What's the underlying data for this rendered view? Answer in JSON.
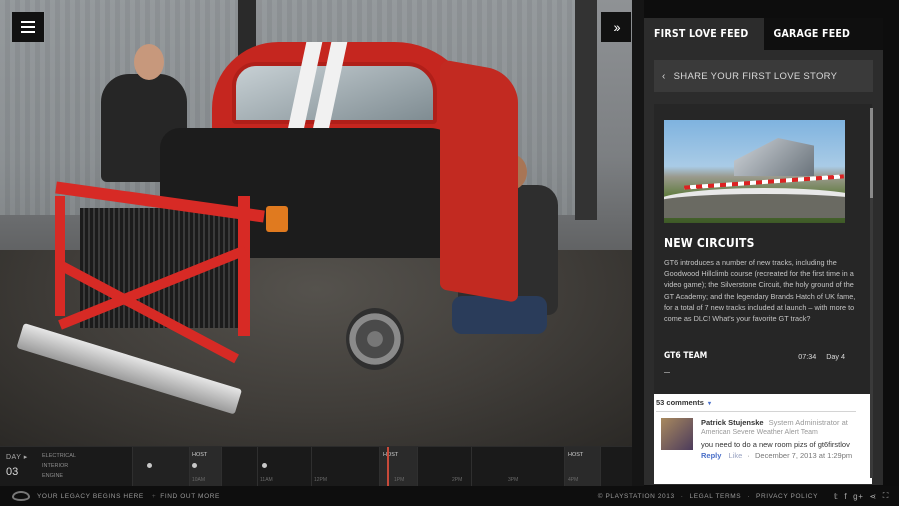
{
  "menu": {
    "icon": "hamburger-icon"
  },
  "collapse": {
    "label": "››",
    "icon": "double-chevron-right-icon"
  },
  "panel": {
    "tabs": [
      {
        "label": "FIRST LOVE FEED",
        "active": true
      },
      {
        "label": "GARAGE FEED",
        "active": false
      }
    ],
    "share": {
      "label": "SHARE YOUR FIRST LOVE STORY",
      "icon": "chevron-left-icon"
    },
    "article": {
      "title": "NEW CIRCUITS",
      "body": "GT6 introduces a number of new tracks, including the Goodwood Hillclimb course (recreated for the first time in a video game); the Silverstone Circuit, the holy ground of the GT Academy; and the legendary Brands Hatch of UK fame, for a total of 7 new tracks included at launch – with more to come as DLC! What's your favorite GT track?",
      "author": "GT6 TEAM",
      "time": "07:34",
      "day": "Day 4"
    },
    "comments": {
      "count_label": "53 comments",
      "items": [
        {
          "name": "Patrick Stujenske",
          "role": "System Administrator at",
          "team": "American Severe Weather Alert Team",
          "text": "you need to do a new room pizs of gt6firstlov",
          "reply": "Reply",
          "like": "Like",
          "datetime": "December 7, 2013 at 1:29pm"
        }
      ]
    }
  },
  "timeline": {
    "day_label": "DAY ▸",
    "day_number": "03",
    "categories": [
      "ELECTRICAL",
      "INTERIOR",
      "ENGINE"
    ],
    "segments": [
      {
        "host": "",
        "label": ""
      },
      {
        "host": "HOST",
        "label": "10AM"
      },
      {
        "host": "",
        "label": "11AM"
      },
      {
        "host": "",
        "label": "12PM"
      },
      {
        "host": "HOST",
        "label": "1PM"
      },
      {
        "host": "",
        "label": "2PM"
      },
      {
        "host": "",
        "label": "3PM"
      },
      {
        "host": "HOST",
        "label": "4PM"
      }
    ]
  },
  "bottombar": {
    "tagline": "YOUR LEGACY BEGINS HERE",
    "find_out": "FIND OUT MORE",
    "copyright": "© PLAYSTATION 2013",
    "legal": "LEGAL TERMS",
    "privacy": "PRIVACY POLICY",
    "social_icons": [
      "twitter-icon",
      "facebook-icon",
      "google-plus-icon",
      "share-icon",
      "fullscreen-icon"
    ]
  }
}
